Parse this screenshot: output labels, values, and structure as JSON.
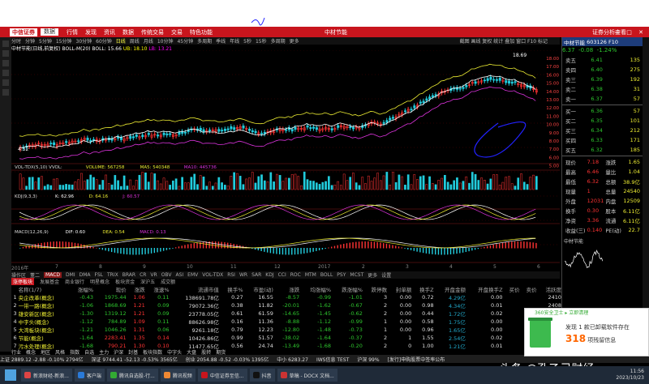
{
  "app": {
    "logo_label": "中信证券",
    "account_dropdown": "数据",
    "menu": [
      "行情",
      "发现",
      "资讯",
      "数据",
      "传统交易",
      "交易",
      "特色功能"
    ],
    "window_title": "中材节能",
    "right_label": "证券分析查看",
    "window_controls": "— □ ✕"
  },
  "period_bar": {
    "items": [
      "分时",
      "分钟",
      "5分钟",
      "15分钟",
      "30分钟",
      "60分钟",
      "日线",
      "周线",
      "月线",
      "10分钟",
      "45分钟",
      "多周期",
      "季线",
      "年线",
      "5秒",
      "15秒",
      "多周期",
      "更多"
    ],
    "active": "日线",
    "tools": "截图 画线 复权 统计 叠加 窗口 F10 标记"
  },
  "chart_legend": {
    "stock": "中材节能(日线,前复权)",
    "boll_name": "BOLL-M(20)",
    "boll": "BOLL: 15.66",
    "ub": "UB: 18.10",
    "lb": "LB: 13.21"
  },
  "main_chart_labels": {
    "high_label": "18.69",
    "low_label": "4.52"
  },
  "vol_legend": {
    "name": "VOL-TDX(5,10) VVOL:",
    "volume": "VOLUME: 567258",
    "ma5": "MA5: 540348",
    "ma10": "MA10: 445736"
  },
  "kdj_legend": {
    "name": "KDJ(9,3,3)",
    "k": "K: 62.96",
    "d": "D: 64.16",
    "j": "J: 60.57"
  },
  "macd_legend": {
    "name": "MACD(12,26,9)",
    "dif": "DIF: 0.60",
    "dea": "DEA: 0.54",
    "macd": "MACD: 0.13"
  },
  "price_axis": [
    "18.00",
    "17.00",
    "16.00",
    "15.00",
    "14.00",
    "13.00",
    "12.00",
    "11.00",
    "10.00",
    "9.00",
    "8.00",
    "7.00",
    "6.00",
    "5.00"
  ],
  "date_axis": [
    "2016年",
    "7",
    "8",
    "9",
    "10",
    "11",
    "12",
    "2017",
    "2",
    "3",
    "4",
    "5",
    "6"
  ],
  "bottom_tab_bar": [
    "操作区",
    "董二",
    "MACD",
    "DMI",
    "DMA",
    "FSL",
    "TRIX",
    "BRAR",
    "CR",
    "VR",
    "OBV",
    "ASI",
    "EMV",
    "VOL-TDX",
    "RSI",
    "WR",
    "SAR",
    "KDJ",
    "CCI",
    "ROC",
    "MTM",
    "BOLL",
    "PSY",
    "MCST",
    "更多",
    "设置"
  ],
  "bottom_tab_active": "MACD",
  "sector_bar": [
    "涨停板块",
    "发展基金",
    "商业银行",
    "明星概念",
    "板块资金",
    "深沪五",
    "成交额"
  ],
  "sector_active": "涨停板块",
  "table": {
    "headers": [
      "",
      "名称(1/7)",
      "涨幅%",
      "现价",
      "涨跌",
      "涨速%",
      "流通市值",
      "换手%",
      "市盈(动)",
      "涨跌",
      "均涨幅%",
      "跌涨幅%",
      "跌停数",
      "封单额",
      "换手Z",
      "开盘金额",
      "开盘换手Z",
      "买价",
      "卖价",
      "活跃度"
    ],
    "rows": [
      [
        "1",
        "央企改革(概念)",
        "-0.43",
        "1975.44",
        "1.06",
        "0.11",
        "138691.78亿",
        "0.27",
        "16.55",
        "-8.57",
        "-0.99",
        "-1.01",
        "3",
        "0.00",
        "0.72",
        "4.29亿",
        "0.00",
        "",
        "",
        "2410"
      ],
      [
        "2",
        "一带一路(概念)",
        "-1.06",
        "1868.69",
        "1.21",
        "0.09",
        "79072.36亿",
        "0.38",
        "11.82",
        "-20.01",
        "-1.62",
        "-0.67",
        "2",
        "0.00",
        "0.98",
        "4.34亿",
        "0.01",
        "",
        "",
        "2408"
      ],
      [
        "3",
        "雄安新区(概念)",
        "-1.30",
        "1319.12",
        "1.21",
        "0.09",
        "23778.05亿",
        "0.61",
        "61.59",
        "-14.65",
        "-1.45",
        "-0.62",
        "2",
        "0.00",
        "0.44",
        "1.72亿",
        "0.02",
        "",
        "",
        ""
      ],
      [
        "4",
        "中字头(概念)",
        "-1.12",
        "784.89",
        "1.09",
        "0.11",
        "88626.98亿",
        "0.16",
        "11.36",
        "-8.88",
        "-1.12",
        "-0.99",
        "1",
        "0.00",
        "0.58",
        "1.75亿",
        "0.00",
        "",
        "",
        ""
      ],
      [
        "5",
        "大湾板块(概念)",
        "-1.21",
        "1046.26",
        "1.31",
        "0.06",
        "9261.18亿",
        "0.79",
        "12.23",
        "-12.80",
        "-1.48",
        "-0.73",
        "1",
        "0.00",
        "0.96",
        "1.65亿",
        "0.00",
        "",
        "",
        ""
      ],
      [
        "6",
        "节能(概念)",
        "-1.64",
        "2283.41",
        "1.35",
        "0.14",
        "10426.86亿",
        "0.99",
        "51.57",
        "-38.02",
        "-1.64",
        "-0.37",
        "2",
        "1",
        "1.55",
        "2.54亿",
        "0.02",
        "",
        "",
        ""
      ],
      [
        "7",
        "污水处理(概念)",
        "-1.68",
        "790.21",
        "1.30",
        "0.10",
        "11477.65亿",
        "0.56",
        "24.74",
        "-13.49",
        "-1.68",
        "-0.20",
        "2",
        "0",
        "1.00",
        "1.21亿",
        "0.01",
        "",
        "",
        ""
      ]
    ]
  },
  "bottom_tabs": [
    "行业",
    "概念",
    "地区",
    "风格",
    "指数",
    "自选",
    "主力",
    "沪深",
    "封基",
    "板块指数",
    "中字头",
    "大盘",
    "股转",
    "期货"
  ],
  "status_bar": {
    "items": [
      "上证 2889.12 -2.88 -0.10% 2794亿",
      "深证 9744.41 -52.13 -0.53% 3565亿",
      "创业 2054.88 -0.52 -0.03% 1395亿",
      "中小 6283.27",
      "IWS信息 TEST",
      "沪深 99%"
    ],
    "marquee": "[发行]申购股票中签率公布"
  },
  "taskbar": {
    "items": [
      {
        "label": "新浪财经-新浪...",
        "color": "#d44"
      },
      {
        "label": "客户端",
        "color": "#2a7ad8"
      },
      {
        "label": "腾讯自选股-行...",
        "color": "#3a3"
      },
      {
        "label": "腾讯视频",
        "color": "#e83"
      },
      {
        "label": "中信证券至信...",
        "color": "#c8151d"
      },
      {
        "label": "抖音",
        "color": "#111"
      },
      {
        "label": "草稿 - DOCX 文档...",
        "color": "#c33"
      }
    ],
    "time": "11:56",
    "date": "2023/10/23"
  },
  "right_panel": {
    "stock_name": "中材节能",
    "stock_code": "603126",
    "tag": "F10",
    "price": "6.37",
    "change": "-0.08",
    "change_pct": "-1.24%",
    "asks": [
      [
        "卖五",
        "6.41",
        "135"
      ],
      [
        "卖四",
        "6.40",
        "275"
      ],
      [
        "卖三",
        "6.39",
        "192"
      ],
      [
        "卖二",
        "6.38",
        "31"
      ],
      [
        "卖一",
        "6.37",
        "57"
      ]
    ],
    "bids": [
      [
        "买一",
        "6.36",
        "57"
      ],
      [
        "买二",
        "6.35",
        "101"
      ],
      [
        "买三",
        "6.34",
        "212"
      ],
      [
        "买四",
        "6.33",
        "171"
      ],
      [
        "买五",
        "6.32",
        "185"
      ]
    ],
    "stats": [
      [
        "现价",
        "7.18",
        "涨跌",
        "1.65"
      ],
      [
        "最高",
        "6.46",
        "量比",
        "1.04"
      ],
      [
        "最低",
        "6.32",
        "总额",
        "38.9亿"
      ],
      [
        "现量",
        "1",
        "总量",
        "24540"
      ],
      [
        "外盘",
        "12031",
        "内盘",
        "12509"
      ],
      [
        "换手",
        "0.30",
        "股本",
        "6.11亿"
      ],
      [
        "净资",
        "3.36",
        "流通",
        "6.11亿"
      ],
      [
        "收益(三)",
        "0.140",
        "PE(动)",
        "22.7"
      ]
    ],
    "mini_section": "中材节能"
  },
  "popup": {
    "header": "360安全卫士 ▸ 立即清理",
    "line1": "发现 1 款已卸载软件存在",
    "count": "318",
    "line2_suffix": "项残留信息"
  },
  "watermark": "头条 @孔乙己财经"
}
